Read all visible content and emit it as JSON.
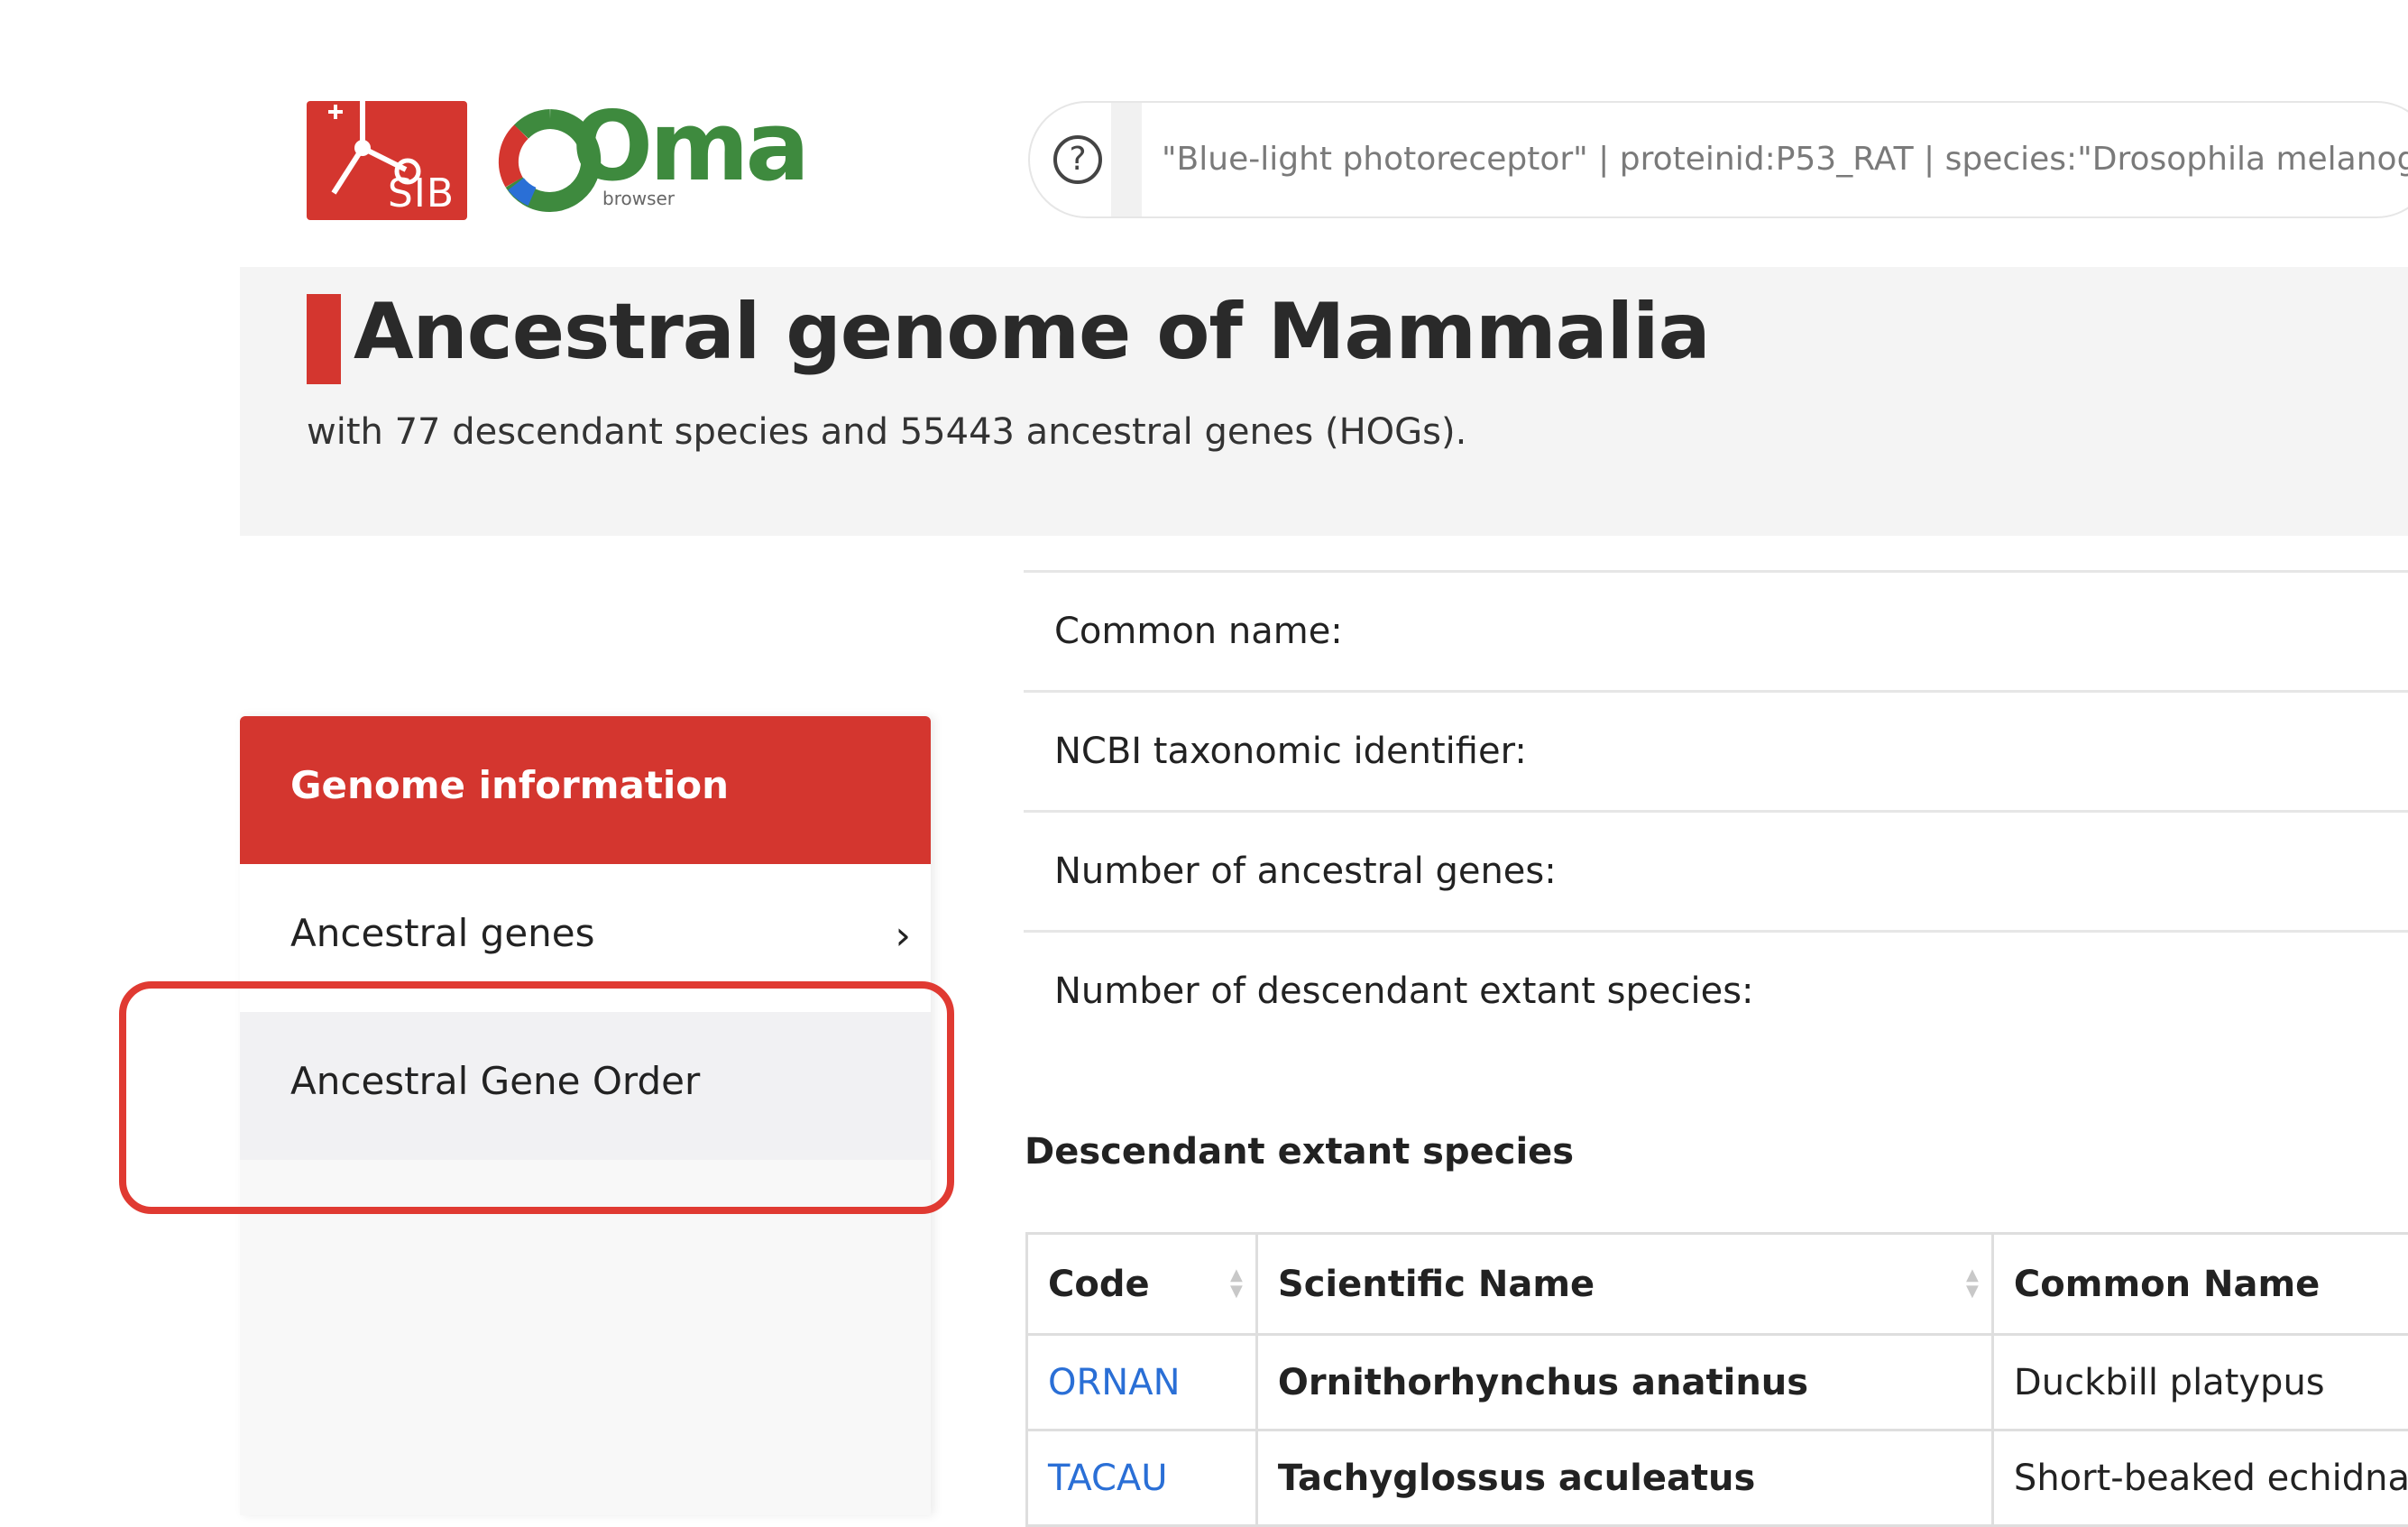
{
  "header": {
    "sib_logo_text": "SIB",
    "oma_logo_text": "Oma",
    "oma_logo_subtext": "browser",
    "search": {
      "help_icon": "?",
      "placeholder": "\"Blue-light photoreceptor\" | proteinid:P53_RAT  | species:\"Drosophila melanogaster\""
    }
  },
  "page": {
    "title": "Ancestral genome of Mammalia",
    "subtitle": "with 77 descendant species and 55443 ancestral genes (HOGs)."
  },
  "sidebar": {
    "items": [
      {
        "label": "Genome information",
        "active": true
      },
      {
        "label": "Ancestral genes",
        "icon": "chevron-right-icon"
      },
      {
        "label": "Ancestral Gene Order"
      }
    ],
    "chevron": "›"
  },
  "info_rows": [
    {
      "label": "Common name:"
    },
    {
      "label": "NCBI taxonomic identifier:"
    },
    {
      "label": "Number of ancestral genes:"
    },
    {
      "label": "Number of descendant extant species:"
    }
  ],
  "descendant_section": {
    "heading": "Descendant extant species",
    "table": {
      "headers": [
        "Code",
        "Scientific Name",
        "Common Name"
      ],
      "rows": [
        {
          "code": "ORNAN",
          "scientific_name": "Ornithorhynchus anatinus",
          "common_name": "Duckbill platypus"
        },
        {
          "code": "TACAU",
          "scientific_name": "Tachyglossus aculeatus",
          "common_name": "Short-beaked echidna"
        }
      ]
    }
  },
  "colors": {
    "brand_red": "#d4362f",
    "oma_green": "#3e8a3e",
    "link_blue": "#2a6fd6",
    "highlight_red": "#e03a32"
  }
}
